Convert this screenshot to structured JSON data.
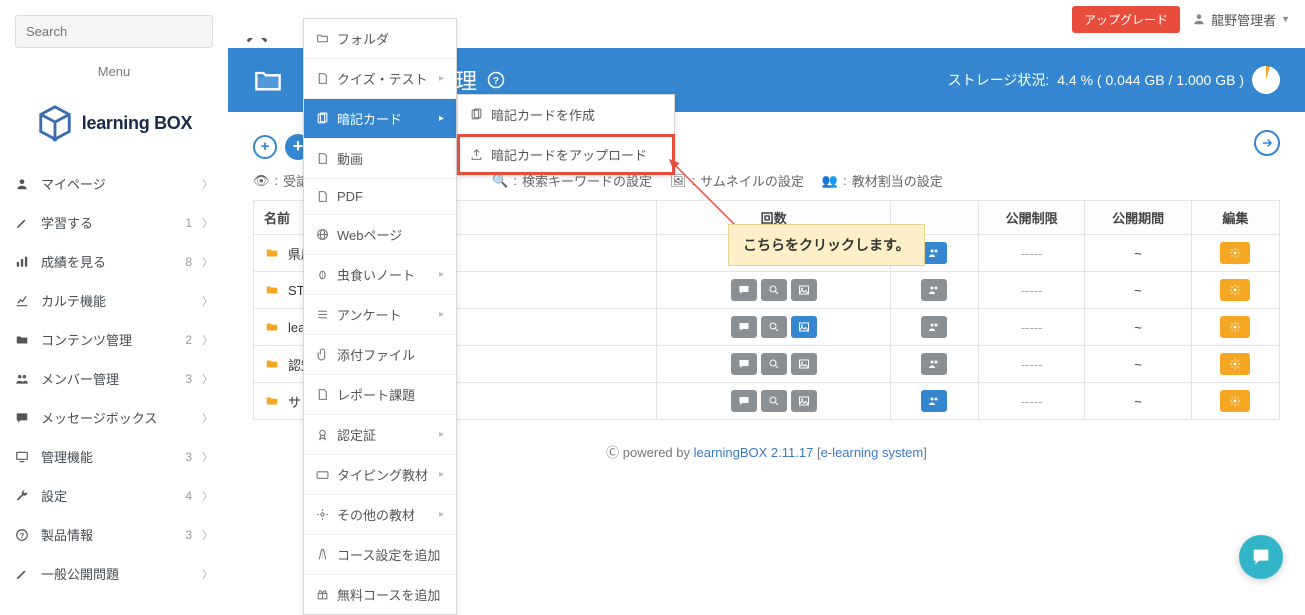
{
  "search": {
    "placeholder": "Search"
  },
  "menu_title": "Menu",
  "logo": {
    "text_a": "learning",
    "text_b": "BOX"
  },
  "nav": [
    {
      "icon": "user",
      "label": "マイページ",
      "badge": ""
    },
    {
      "icon": "pencil",
      "label": "学習する",
      "badge": "1"
    },
    {
      "icon": "bars",
      "label": "成績を見る",
      "badge": "8"
    },
    {
      "icon": "stats",
      "label": "カルテ機能",
      "badge": ""
    },
    {
      "icon": "folder",
      "label": "コンテンツ管理",
      "badge": "2"
    },
    {
      "icon": "users",
      "label": "メンバー管理",
      "badge": "3"
    },
    {
      "icon": "comment",
      "label": "メッセージボックス",
      "badge": ""
    },
    {
      "icon": "monitor",
      "label": "管理機能",
      "badge": "3"
    },
    {
      "icon": "wrench",
      "label": "設定",
      "badge": "4"
    },
    {
      "icon": "help",
      "label": "製品情報",
      "badge": "3"
    },
    {
      "icon": "pencil",
      "label": "一般公開問題",
      "badge": ""
    }
  ],
  "topbar": {
    "upgrade": "アップグレード",
    "user": "龍野管理者"
  },
  "bh": {
    "title_rest": "管理",
    "storage_label": "ストレージ状況:",
    "storage_value": "4.4 % ( 0.044 GB / 1.000 GB )"
  },
  "filters": {
    "f1": "受講",
    "f2": "検索キーワードの設定",
    "f3": "サムネイルの設定",
    "f4": "教材割当の設定"
  },
  "table": {
    "headers": {
      "name": "名前",
      "count": "回数",
      "limit": "公開制限",
      "period": "公開期間",
      "edit": "編集"
    },
    "rows": [
      {
        "name": "県庁",
        "blue_img": false,
        "blue_grp": true
      },
      {
        "name": "ST",
        "blue_img": false,
        "blue_grp": false
      },
      {
        "name": "lea",
        "blue_img": true,
        "blue_grp": false
      },
      {
        "name": "認知",
        "blue_img": false,
        "blue_grp": false
      },
      {
        "name": "サン",
        "blue_img": false,
        "blue_grp": true
      }
    ],
    "dash": "-----",
    "tilde": "~"
  },
  "crumb": "メント",
  "menu1": [
    {
      "icon": "folder-o",
      "label": "フォルダ",
      "sub": false
    },
    {
      "icon": "file",
      "label": "クイズ・テスト",
      "sub": true
    },
    {
      "icon": "cards",
      "label": "暗記カード",
      "sub": true,
      "hl": true
    },
    {
      "icon": "file",
      "label": "動画",
      "sub": false
    },
    {
      "icon": "file",
      "label": "PDF",
      "sub": false
    },
    {
      "icon": "globe",
      "label": "Webページ",
      "sub": false
    },
    {
      "icon": "bug",
      "label": "虫食いノート",
      "sub": true
    },
    {
      "icon": "list",
      "label": "アンケート",
      "sub": true
    },
    {
      "icon": "clip",
      "label": "添付ファイル",
      "sub": false
    },
    {
      "icon": "file",
      "label": "レポート課題",
      "sub": false
    },
    {
      "icon": "cert",
      "label": "認定証",
      "sub": true
    },
    {
      "icon": "keyboard",
      "label": "タイピング教材",
      "sub": true
    },
    {
      "icon": "gear",
      "label": "その他の教材",
      "sub": true
    },
    {
      "icon": "road",
      "label": "コース設定を追加",
      "sub": false
    },
    {
      "icon": "gift",
      "label": "無料コースを追加",
      "sub": false
    }
  ],
  "menu2": [
    {
      "icon": "cards",
      "label": "暗記カードを作成"
    },
    {
      "icon": "upload",
      "label": "暗記カードをアップロード",
      "boxed": true
    }
  ],
  "callout": "こちらをクリックします。",
  "footer": {
    "pre": "Ⓒ powered by ",
    "link1": "learningBOX 2.11.17",
    "mid": " [",
    "link2": "e-learning system",
    "post": "]"
  }
}
